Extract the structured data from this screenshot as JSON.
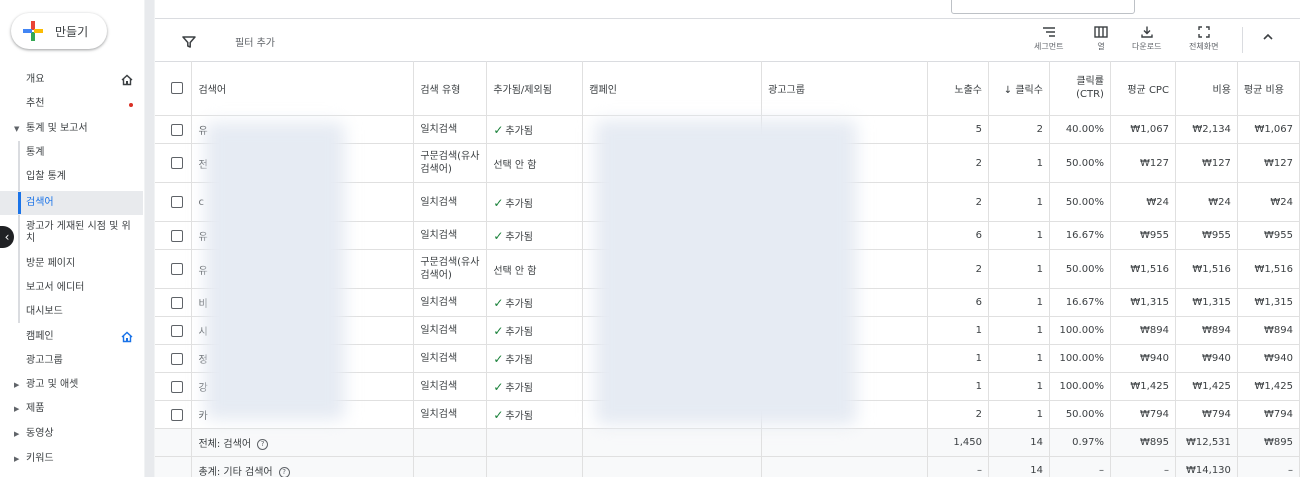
{
  "create_button": {
    "label": "만들기"
  },
  "nav": {
    "items": [
      {
        "label": "개요",
        "icon": "home-icon"
      },
      {
        "label": "추천",
        "badge": "red-dot"
      },
      {
        "label": "통계 및 보고서",
        "expanded": true
      },
      {
        "label": "통계"
      },
      {
        "label": "입찰 통계"
      },
      {
        "label": "검색어",
        "selected": true
      },
      {
        "label": "광고가 게재된 시점 및 위치"
      },
      {
        "label": "방문 페이지"
      },
      {
        "label": "보고서 에디터"
      },
      {
        "label": "대시보드"
      },
      {
        "label": "캠페인",
        "icon": "home-icon"
      },
      {
        "label": "광고그룹"
      },
      {
        "label": "광고 및 애셋",
        "collapsed": true
      },
      {
        "label": "제품",
        "collapsed": true
      },
      {
        "label": "동영상",
        "collapsed": true
      },
      {
        "label": "키워드",
        "collapsed": true
      }
    ]
  },
  "toolbar": {
    "filter_add": "필터 추가",
    "segment": "세그먼트",
    "columns": "열",
    "download": "다운로드",
    "fullscreen": "전체화면"
  },
  "table": {
    "headers": {
      "search_term": "검색어",
      "match_type": "검색 유형",
      "added_excluded": "추가됨/제외됨",
      "campaign": "캠페인",
      "ad_group": "광고그룹",
      "impressions": "노출수",
      "clicks": "클릭수",
      "clicks_sort": "↓",
      "ctr": "클릭률 (CTR)",
      "avg_cpc": "평균 CPC",
      "cost": "비용",
      "avg_cost": "평균 비용"
    },
    "rows": [
      {
        "term": "유",
        "match": "일치검색",
        "status": "추가됨",
        "impr": "5",
        "clicks": "2",
        "ctr": "40.00%",
        "cpc": "₩1,067",
        "cost": "₩2,134",
        "avg": "₩1,067"
      },
      {
        "term": "전",
        "match": "구문검색(유사 검색어)",
        "status": "선택 안 함",
        "impr": "2",
        "clicks": "1",
        "ctr": "50.00%",
        "cpc": "₩127",
        "cost": "₩127",
        "avg": "₩127"
      },
      {
        "term": "c",
        "match": "일치검색",
        "status": "추가됨",
        "impr": "2",
        "clicks": "1",
        "ctr": "50.00%",
        "cpc": "₩24",
        "cost": "₩24",
        "avg": "₩24"
      },
      {
        "term": "유",
        "match": "일치검색",
        "status": "추가됨",
        "impr": "6",
        "clicks": "1",
        "ctr": "16.67%",
        "cpc": "₩955",
        "cost": "₩955",
        "avg": "₩955"
      },
      {
        "term": "유",
        "match": "구문검색(유사 검색어)",
        "status": "선택 안 함",
        "impr": "2",
        "clicks": "1",
        "ctr": "50.00%",
        "cpc": "₩1,516",
        "cost": "₩1,516",
        "avg": "₩1,516"
      },
      {
        "term": "비",
        "match": "일치검색",
        "status": "추가됨",
        "impr": "6",
        "clicks": "1",
        "ctr": "16.67%",
        "cpc": "₩1,315",
        "cost": "₩1,315",
        "avg": "₩1,315"
      },
      {
        "term": "시",
        "match": "일치검색",
        "status": "추가됨",
        "impr": "1",
        "clicks": "1",
        "ctr": "100.00%",
        "cpc": "₩894",
        "cost": "₩894",
        "avg": "₩894"
      },
      {
        "term": "정",
        "match": "일치검색",
        "status": "추가됨",
        "impr": "1",
        "clicks": "1",
        "ctr": "100.00%",
        "cpc": "₩940",
        "cost": "₩940",
        "avg": "₩940"
      },
      {
        "term": "강",
        "match": "일치검색",
        "status": "추가됨",
        "impr": "1",
        "clicks": "1",
        "ctr": "100.00%",
        "cpc": "₩1,425",
        "cost": "₩1,425",
        "avg": "₩1,425"
      },
      {
        "term": "카",
        "match": "일치검색",
        "status": "추가됨",
        "impr": "2",
        "clicks": "1",
        "ctr": "50.00%",
        "cpc": "₩794",
        "cost": "₩794",
        "avg": "₩794"
      }
    ],
    "total": {
      "label": "전체: 검색어",
      "impr": "1,450",
      "clicks": "14",
      "ctr": "0.97%",
      "cpc": "₩895",
      "cost": "₩12,531",
      "avg": "₩895"
    },
    "total2": {
      "label": "총계: 기타 검색어",
      "impr": "–",
      "clicks": "14",
      "ctr": "–",
      "cpc": "–",
      "cost": "₩14,130",
      "avg": "–"
    }
  },
  "colors": {
    "accent": "#1a73e8",
    "check": "#188038",
    "badge": "#d93025"
  }
}
